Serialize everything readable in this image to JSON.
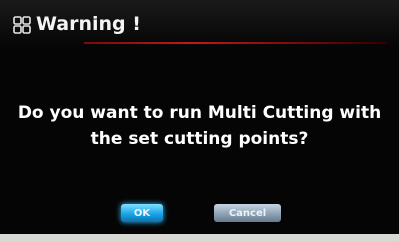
{
  "dialog": {
    "title": "Warning !",
    "title_icon": "grid-icon",
    "message": "Do you want to run Multi Cutting with the set cutting points?",
    "buttons": {
      "ok_label": "OK",
      "cancel_label": "Cancel"
    }
  },
  "colors": {
    "background": "#050505",
    "text": "#ffffff",
    "accent_line": "#c01a1a",
    "ok_button": "#1ba5e6",
    "cancel_button": "#8fa3b5"
  }
}
